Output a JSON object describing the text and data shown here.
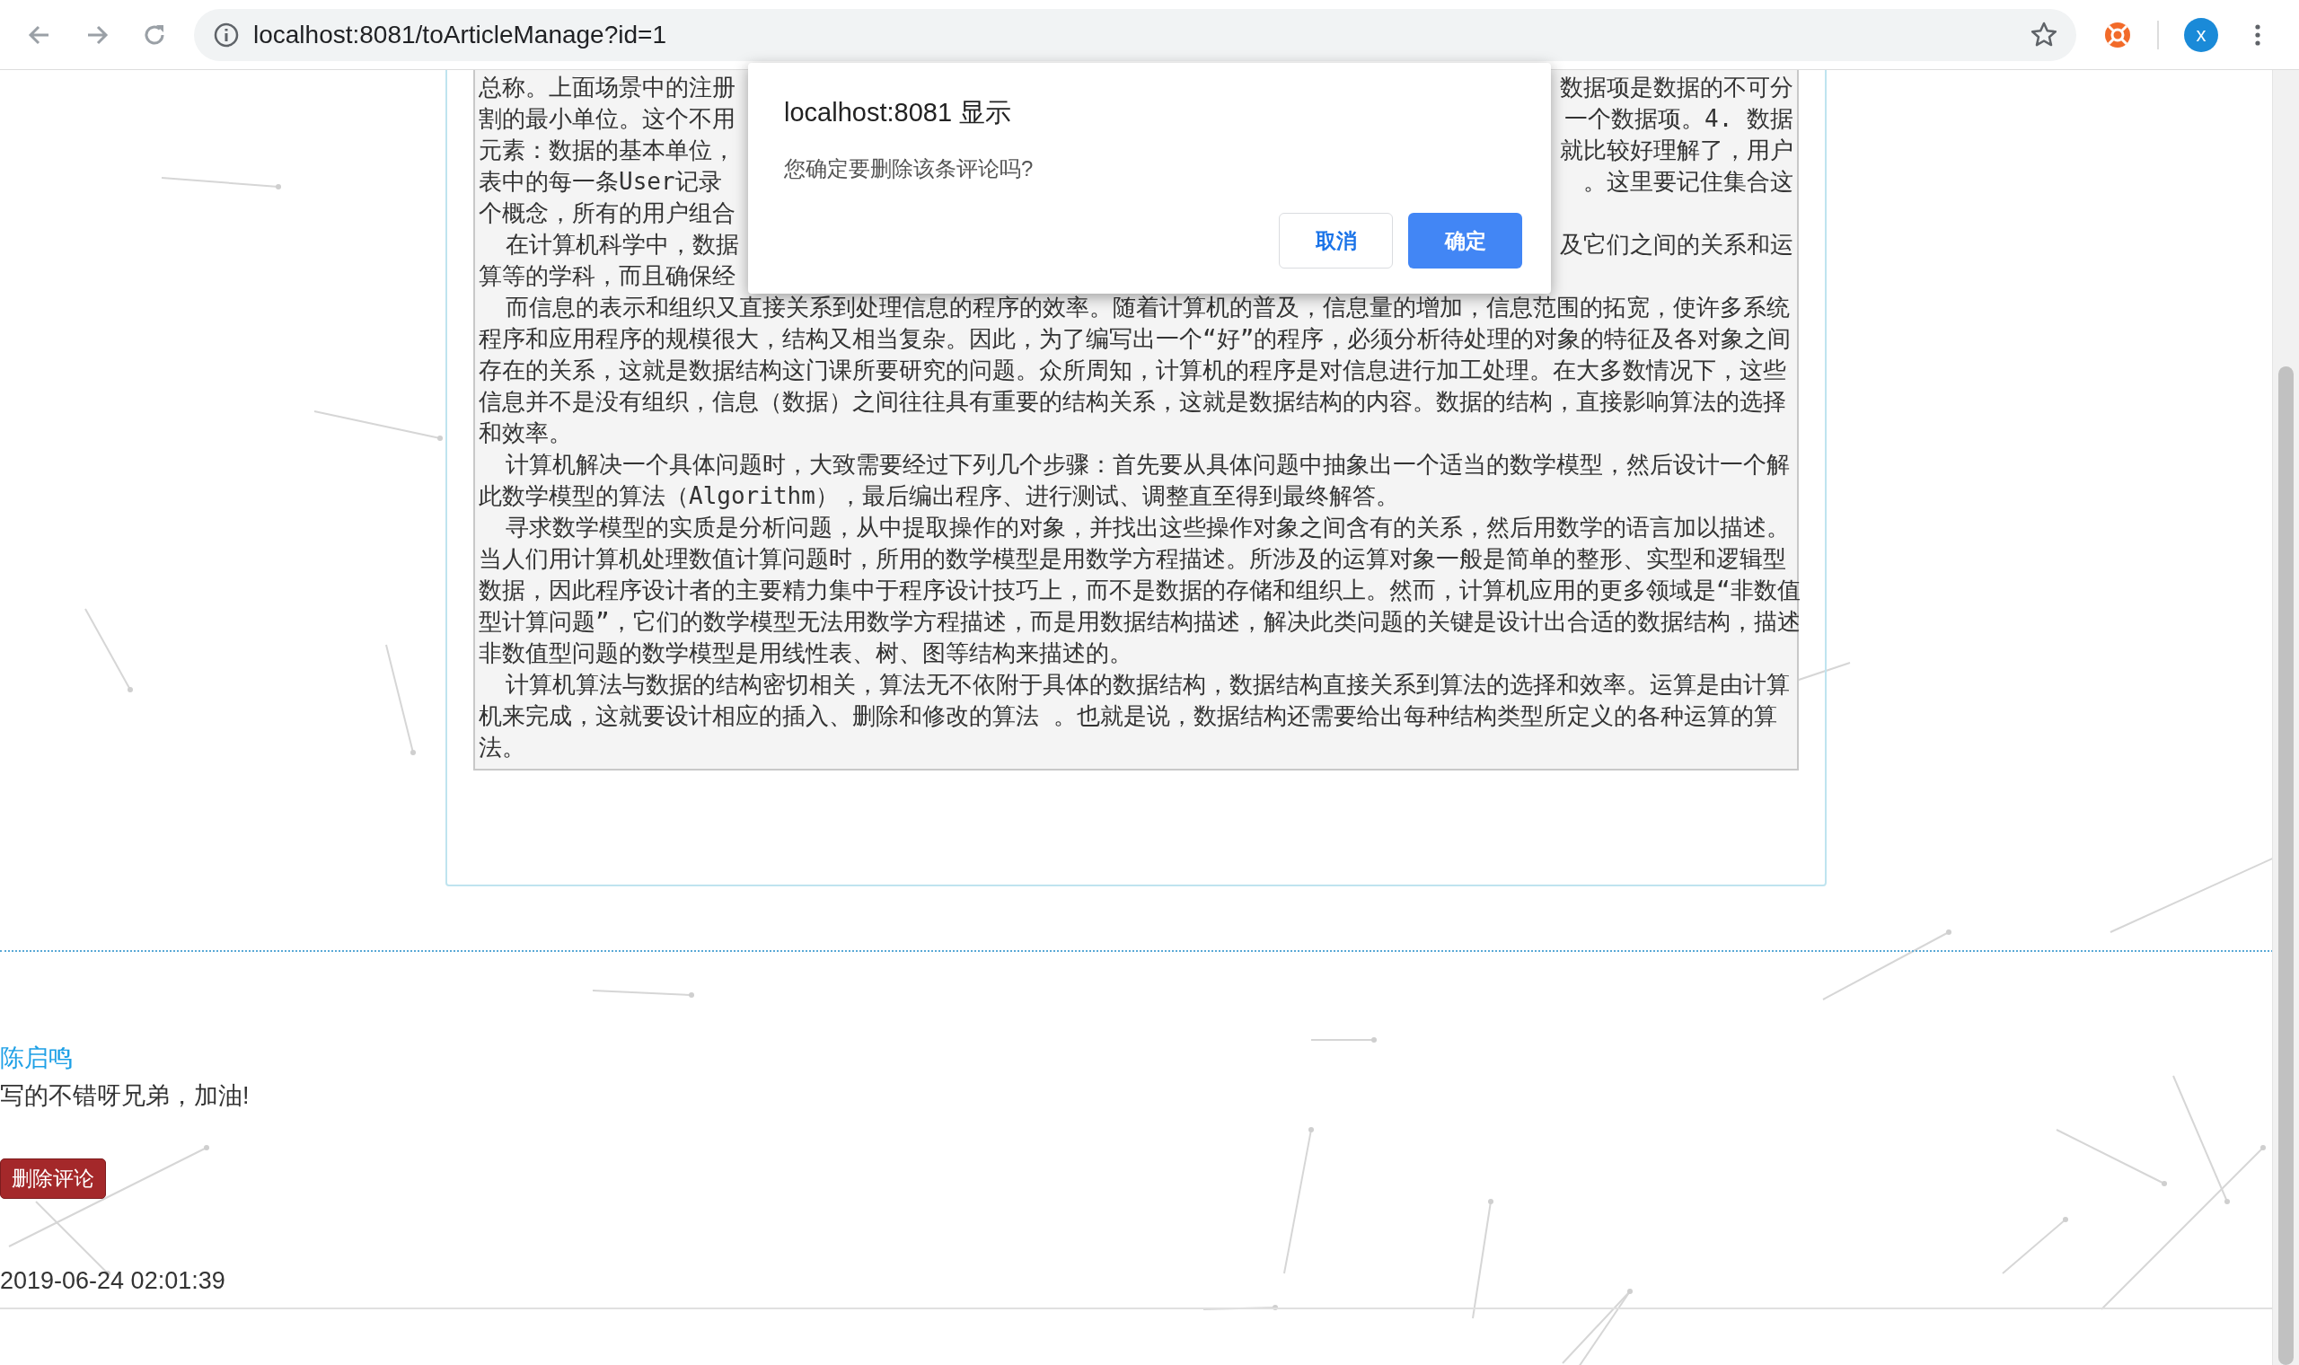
{
  "browser": {
    "url": "localhost:8081/toArticleManage?id=1",
    "profile_initial": "x"
  },
  "article": {
    "lines": [
      {
        "kind": "split",
        "indent": false,
        "left": "总称。上面场景中的注册",
        "right": "数据项是数据的不可分"
      },
      {
        "kind": "split",
        "indent": false,
        "left": "割的最小单位。这个不用",
        "right": "一个数据项。4. 数据"
      },
      {
        "kind": "split",
        "indent": false,
        "left": "元素：数据的基本单位，",
        "right": "就比较好理解了，用户"
      },
      {
        "kind": "split",
        "indent": false,
        "left": "表中的每一条User记录",
        "right": "。这里要记住集合这"
      },
      {
        "kind": "split",
        "indent": false,
        "left": "个概念，所有的用户组合"
      },
      {
        "kind": "split",
        "indent": true,
        "left": "在计算机科学中，数据",
        "right": "及它们之间的关系和运"
      },
      {
        "kind": "split",
        "indent": false,
        "left": "算等的学科，而且确保经"
      },
      {
        "kind": "full",
        "indent": true,
        "text": "而信息的表示和组织又直接关系到处理信息的程序的效率。随着计算机的普及，信息量的增加，信息范围的拓宽，使许多系统"
      },
      {
        "kind": "full",
        "indent": false,
        "text": "程序和应用程序的规模很大，结构又相当复杂。因此，为了编写出一个“好”的程序，必须分析待处理的对象的特征及各对象之间"
      },
      {
        "kind": "full",
        "indent": false,
        "text": "存在的关系，这就是数据结构这门课所要研究的问题。众所周知，计算机的程序是对信息进行加工处理。在大多数情况下，这些"
      },
      {
        "kind": "full",
        "indent": false,
        "text": "信息并不是没有组织，信息（数据）之间往往具有重要的结构关系，这就是数据结构的内容。数据的结构，直接影响算法的选择"
      },
      {
        "kind": "full",
        "indent": false,
        "text": "和效率。"
      },
      {
        "kind": "full",
        "indent": true,
        "text": "计算机解决一个具体问题时，大致需要经过下列几个步骤：首先要从具体问题中抽象出一个适当的数学模型，然后设计一个解"
      },
      {
        "kind": "full",
        "indent": false,
        "text": "此数学模型的算法（Algorithm），最后编出程序、进行测试、调整直至得到最终解答。"
      },
      {
        "kind": "full",
        "indent": true,
        "text": "寻求数学模型的实质是分析问题，从中提取操作的对象，并找出这些操作对象之间含有的关系，然后用数学的语言加以描述。"
      },
      {
        "kind": "full",
        "indent": false,
        "text": "当人们用计算机处理数值计算问题时，所用的数学模型是用数学方程描述。所涉及的运算对象一般是简单的整形、实型和逻辑型"
      },
      {
        "kind": "full",
        "indent": false,
        "text": "数据，因此程序设计者的主要精力集中于程序设计技巧上，而不是数据的存储和组织上。然而，计算机应用的更多领域是“非数值"
      },
      {
        "kind": "full",
        "indent": false,
        "text": "型计算问题”，它们的数学模型无法用数学方程描述，而是用数据结构描述，解决此类问题的关键是设计出合适的数据结构，描述"
      },
      {
        "kind": "full",
        "indent": false,
        "text": "非数值型问题的数学模型是用线性表、树、图等结构来描述的。"
      },
      {
        "kind": "full",
        "indent": true,
        "text": "计算机算法与数据的结构密切相关，算法无不依附于具体的数据结构，数据结构直接关系到算法的选择和效率。运算是由计算"
      },
      {
        "kind": "full",
        "indent": false,
        "text": "机来完成，这就要设计相应的插入、删除和修改的算法 。也就是说，数据结构还需要给出每种结构类型所定义的各种运算的算"
      },
      {
        "kind": "full",
        "indent": false,
        "text": "法。"
      }
    ]
  },
  "dialog": {
    "title": "localhost:8081 显示",
    "message": "您确定要删除该条评论吗?",
    "buttons": [
      {
        "label": "取消",
        "kind": "secondary"
      },
      {
        "label": "确定",
        "kind": "primary"
      }
    ]
  },
  "comment": {
    "author": "陈启鸣",
    "text": "写的不错呀兄弟，加油!",
    "delete_button": "删除评论",
    "time": "2019-06-24 02:01:39"
  }
}
